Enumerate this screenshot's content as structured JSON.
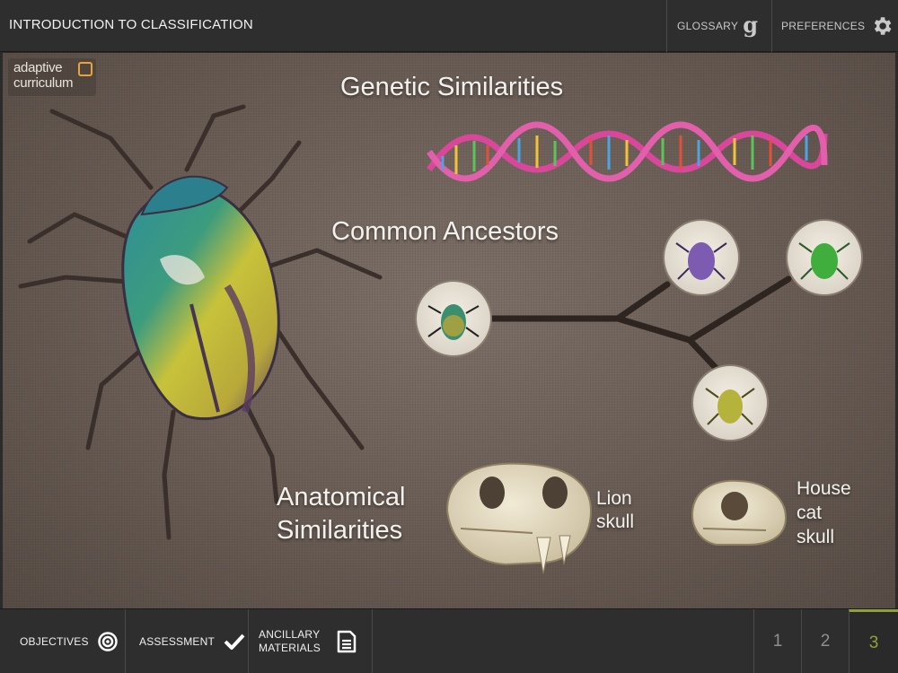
{
  "header": {
    "title": "INTRODUCTION TO CLASSIFICATION",
    "glossary_label": "GLOSSARY",
    "glossary_icon": "g-glossary-icon",
    "preferences_label": "PREFERENCES",
    "preferences_icon": "gear-icon"
  },
  "logo": {
    "line1": "adaptive",
    "line2": "curriculum"
  },
  "scene": {
    "genetic_heading": "Genetic Similarities",
    "common_heading": "Common Ancestors",
    "anatomical_line1": "Anatomical",
    "anatomical_line2": "Similarities",
    "lion_line1": "Lion",
    "lion_line2": "skull",
    "cat_line1": "House",
    "cat_line2": "cat",
    "cat_line3": "skull",
    "colors": {
      "background": "#7b6e66",
      "dna": "#d9479a",
      "beetle_purple": "#7c5bb0",
      "beetle_green": "#3fae3c",
      "beetle_yellow": "#b6b33c"
    }
  },
  "footer": {
    "objectives_label": "OBJECTIVES",
    "objectives_icon": "target-icon",
    "assessment_label": "ASSESSMENT",
    "assessment_icon": "checkmark-icon",
    "ancillary_line1": "ANCILLARY",
    "ancillary_line2": "MATERIALS",
    "ancillary_icon": "document-icon",
    "pages": [
      "1",
      "2",
      "3"
    ],
    "active_page": "3",
    "accent": "#8fa23a"
  }
}
